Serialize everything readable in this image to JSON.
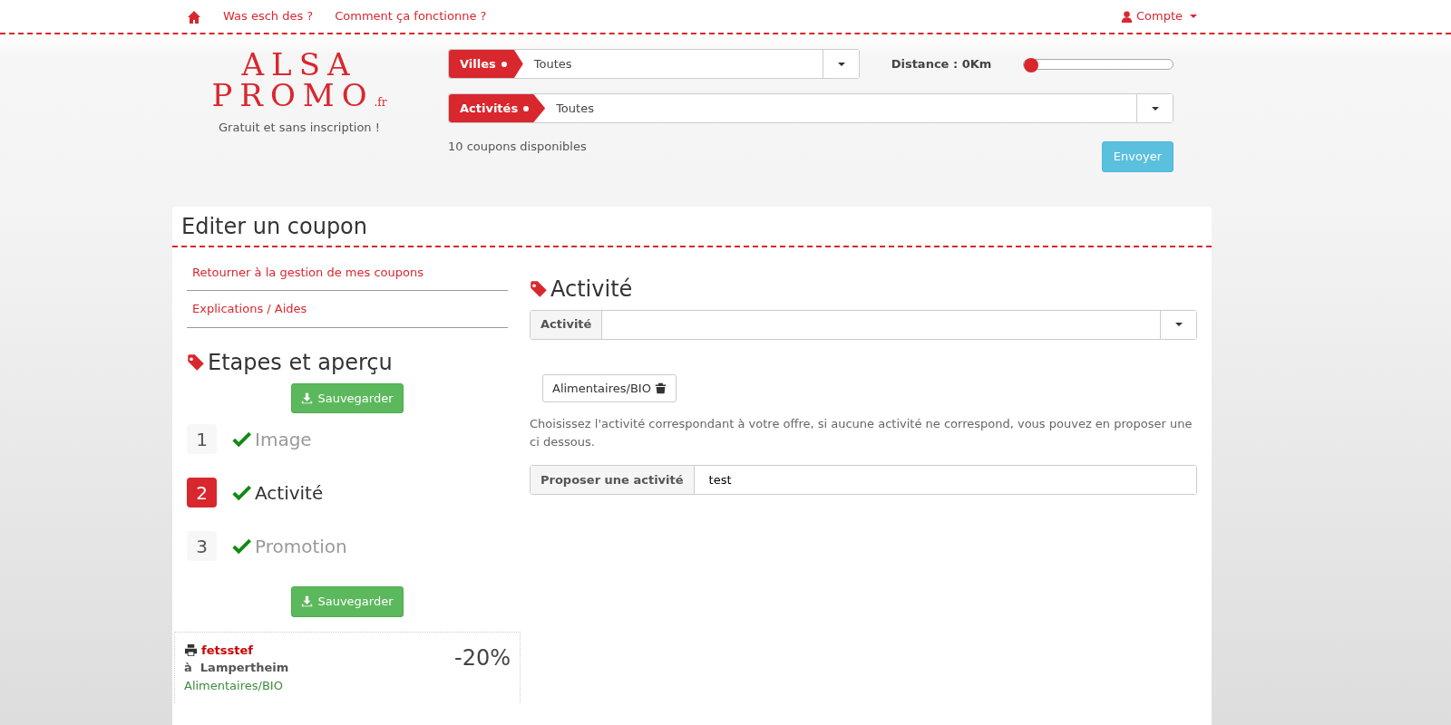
{
  "nav": {
    "links": [
      {
        "label": "Was esch des ?"
      },
      {
        "label": "Comment ça fonctionne ?"
      }
    ],
    "account": "Compte"
  },
  "logo": {
    "line_1": "ALSA",
    "line_2": "PROMO",
    "suffix": ".fr"
  },
  "tagline": "Gratuit et sans inscription !",
  "filters": [
    {
      "label": "Villes",
      "value": "Toutes"
    },
    {
      "label": "Activités",
      "value": "Toutes"
    }
  ],
  "distance": {
    "label": "Distance : 0Km",
    "level": 0
  },
  "coupon_count": "10 coupons disponibles",
  "send_button": "Envoyer",
  "page_title": "Editer un coupon",
  "side_links": [
    {
      "label": "Retourner à la gestion de mes coupons"
    },
    {
      "label": "Explications / Aides"
    }
  ],
  "steps_title": "Etapes et aperçu",
  "save_buttons": [
    "Sauvegarder",
    "Sauvegarder"
  ],
  "steps": [
    {
      "number": "1",
      "label": "Image",
      "done": true,
      "selected": false
    },
    {
      "number": "2",
      "label": "Activité",
      "done": true,
      "selected": true
    },
    {
      "number": "3",
      "label": "Promotion",
      "done": true,
      "selected": false
    }
  ],
  "preview": {
    "name": "fetsstef",
    "prefix": "à",
    "city": "Lampertheim",
    "category": "Alimentaires/BIO",
    "discount": "-20%"
  },
  "section_title": "Activité",
  "activity_select": {
    "label": "Activité"
  },
  "chosen_tags": [
    {
      "label": "Alimentaires/BIO"
    }
  ],
  "help_text": "Choisissez l'activité correspondant à  votre offre, si aucune activité ne correspond, vous pouvez en proposer une ci dessous.",
  "propose_field": {
    "label": "Proposer une activité",
    "value": "test"
  }
}
